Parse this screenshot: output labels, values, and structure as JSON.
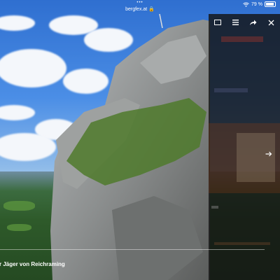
{
  "status_bar": {
    "dots": "•••",
    "url": "bergfex.at 🔒",
    "wifi": "wifi-icon",
    "battery_text": "79 %",
    "battery_level": 0.79
  },
  "toolbar": {
    "icons": [
      "window-icon",
      "menu-icon",
      "share-icon",
      "close-icon"
    ]
  },
  "next_icon": "arrow-right-icon",
  "caption": "r Jäger von Reichraming",
  "colors": {
    "overlay": "#141414",
    "sky": "#3f83de",
    "grass": "#3e6b2e"
  }
}
